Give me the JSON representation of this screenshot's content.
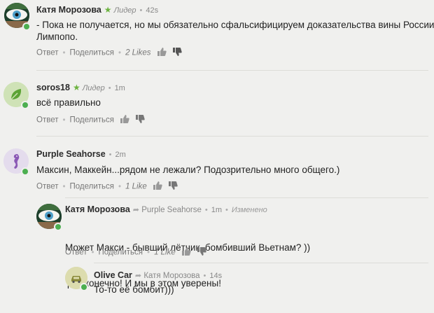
{
  "labels": {
    "reply": "Ответ",
    "share": "Поделиться"
  },
  "comments": [
    {
      "author": "Катя Морозова",
      "badge": "Лидер",
      "time": "42s",
      "text_lines": [
        "- Пока не получается, но мы обязательно сфальсифицируем доказательства вины России!, -",
        "Лимпопо."
      ],
      "likes": "2 Likes"
    },
    {
      "author": "soros18",
      "badge": "Лидер",
      "time": "1m",
      "text_lines": [
        "всё правильно"
      ]
    },
    {
      "author": "Purple Seahorse",
      "time": "2m",
      "text_lines": [
        "Максин, Маккейн...рядом не лежали? Подозрительно много общего.)"
      ],
      "likes": "1 Like"
    },
    {
      "author": "Катя Морозова",
      "reply_to": "Purple Seahorse",
      "time": "1m",
      "edited": "Изменено",
      "text_lines": [
        "Может Макси - бывший лётчик, бомбивший Вьетнам? ))",
        " Да, конечно! И мы в этом уверены!"
      ],
      "likes": "1 Like"
    },
    {
      "author": "Olive Car",
      "reply_to": "Катя Морозова",
      "time": "14s",
      "text_lines": [
        "То-то её бомбит)))"
      ]
    }
  ],
  "colors": {
    "leader_star": "#6cb33f",
    "online": "#4caf50"
  }
}
